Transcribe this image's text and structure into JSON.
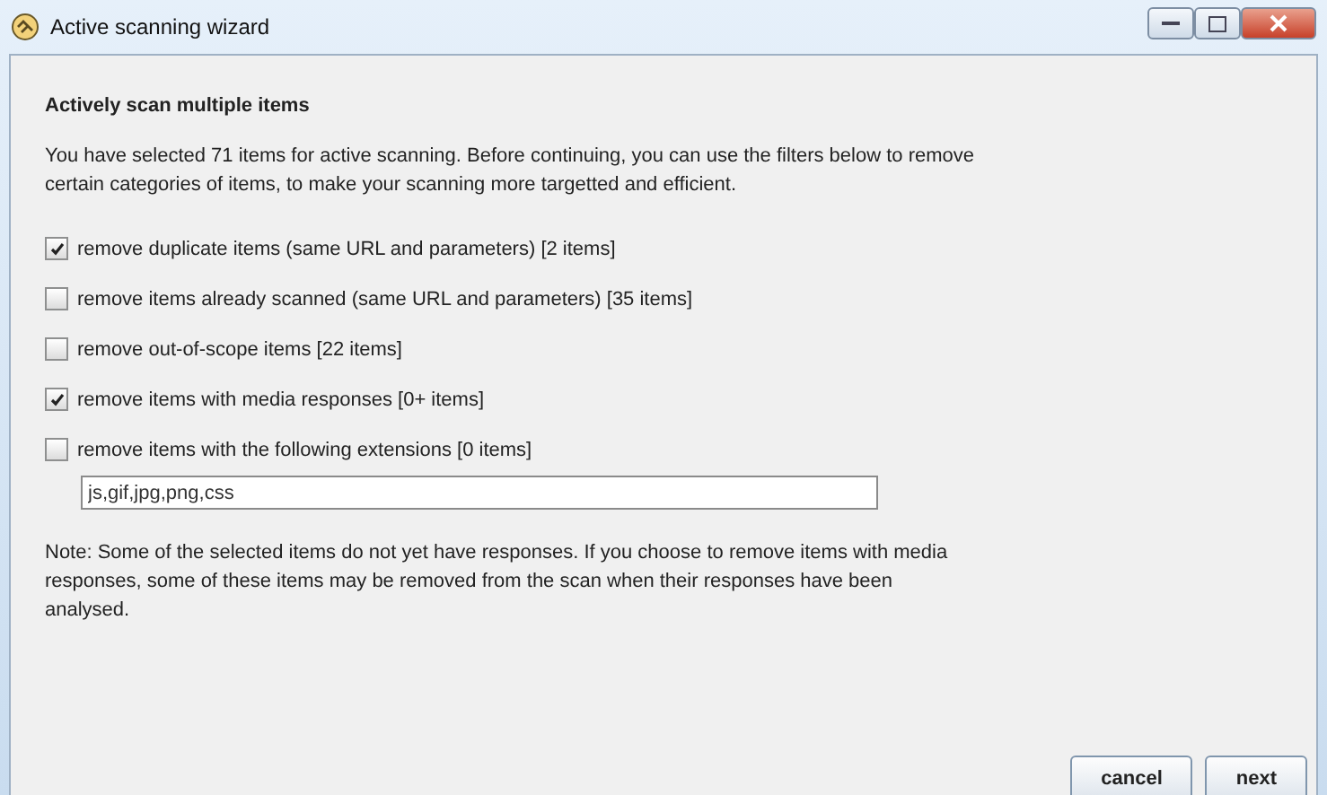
{
  "window": {
    "title": "Active scanning wizard"
  },
  "heading": "Actively scan multiple items",
  "intro": "You have selected 71 items for active scanning. Before continuing, you can use the filters below to remove certain categories of items, to make your scanning more targetted and efficient.",
  "filters": [
    {
      "label": "remove duplicate items (same URL and parameters) [2 items]",
      "checked": true
    },
    {
      "label": "remove items already scanned (same URL and parameters) [35 items]",
      "checked": false
    },
    {
      "label": "remove out-of-scope items [22 items]",
      "checked": false
    },
    {
      "label": "remove items with media responses [0+ items]",
      "checked": true
    },
    {
      "label": "remove items with the following extensions [0 items]",
      "checked": false
    }
  ],
  "extensions_field": {
    "value": "js,gif,jpg,png,css"
  },
  "note": "Note: Some of the selected items do not yet have responses. If you choose to remove items with media responses, some of these items may be removed from the scan when their responses have been analysed.",
  "buttons": [
    "cancel",
    "next"
  ]
}
